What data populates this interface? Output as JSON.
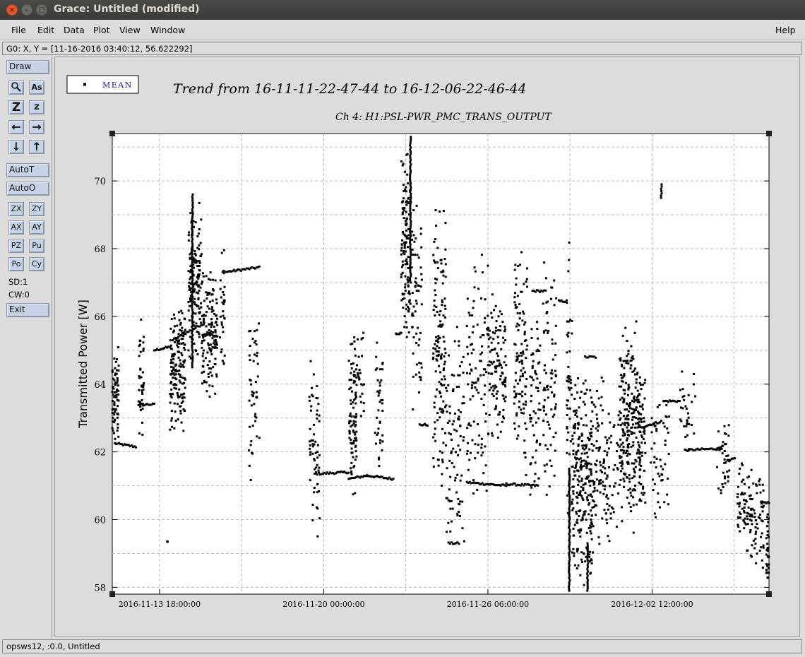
{
  "window": {
    "title": "Grace: Untitled (modified)",
    "close_glyph": "×",
    "min_glyph": "–",
    "max_glyph": "□"
  },
  "menu": {
    "file": "File",
    "edit": "Edit",
    "data": "Data",
    "plot": "Plot",
    "view": "View",
    "window": "Window",
    "help": "Help"
  },
  "locator": "G0: X, Y = [11-16-2016 03:40:12, 56.622292]",
  "toolbar": {
    "draw": "Draw",
    "autot": "AutoT",
    "autoo": "AutoO",
    "zx": "ZX",
    "zy": "ZY",
    "ax": "AX",
    "ay": "AY",
    "pz": "PZ",
    "pu": "Pu",
    "po": "Po",
    "cy": "Cy",
    "sd": "SD:1",
    "cw": "CW:0",
    "exit": "Exit",
    "zoom_icon": "magnifier-icon",
    "autoscale_text_icon": "As",
    "zoom_z_big": "Z",
    "zoom_z_small": "z",
    "left_arrow": "←",
    "right_arrow": "→",
    "down_arrow": "↓",
    "up_arrow": "↑"
  },
  "status": "opsws12, :0.0, Untitled",
  "chart_data": {
    "type": "scatter",
    "title": "Trend from 16-11-11-22-47-44 to 16-12-06-22-46-44",
    "subtitle": "Ch 4: H1:PSL-PWR_PMC_TRANS_OUTPUT",
    "ylabel": "Transmitted Power [W]",
    "xlabel": "",
    "legend": [
      "MEAN"
    ],
    "legend_position": "top-left",
    "grid": true,
    "ylim": [
      57.8,
      71.4
    ],
    "yticks": [
      58,
      60,
      62,
      64,
      66,
      68,
      70
    ],
    "xlim_days": [
      0,
      25
    ],
    "xtick_labels": [
      "2016-11-13 18:00:00",
      "2016-11-20 00:00:00",
      "2016-11-26 06:00:00",
      "2016-12-02 12:00:00"
    ],
    "xtick_days": [
      1.8,
      8.05,
      14.3,
      20.55
    ],
    "colors": {
      "marker": "#000000",
      "legend_text": "#1a1aa0",
      "grid": "#b8b8b8"
    },
    "series": [
      {
        "name": "MEAN",
        "flat_segments": [
          [
            0.1,
            0.9,
            62.25,
            62.15
          ],
          [
            1.0,
            1.6,
            63.4,
            63.4
          ],
          [
            1.6,
            2.2,
            65.0,
            65.1
          ],
          [
            2.3,
            3.5,
            65.3,
            65.8
          ],
          [
            3.5,
            4.0,
            65.5,
            65.4
          ],
          [
            4.2,
            5.6,
            67.3,
            67.45
          ],
          [
            7.7,
            9.0,
            61.35,
            61.4
          ],
          [
            9.0,
            9.7,
            61.2,
            61.3
          ],
          [
            9.7,
            10.7,
            61.3,
            61.2
          ],
          [
            10.8,
            11.0,
            65.5,
            65.5
          ],
          [
            11.7,
            12.0,
            62.8,
            62.8
          ],
          [
            12.8,
            13.2,
            59.3,
            59.3
          ],
          [
            13.5,
            15.0,
            61.1,
            61.0
          ],
          [
            15.0,
            16.2,
            61.05,
            61.0
          ],
          [
            16.0,
            16.5,
            66.75,
            66.75
          ],
          [
            17.0,
            17.3,
            66.45,
            66.45
          ],
          [
            18.0,
            18.4,
            64.8,
            64.8
          ],
          [
            20.0,
            20.9,
            62.7,
            62.9
          ],
          [
            21.0,
            21.6,
            63.5,
            63.5
          ],
          [
            21.8,
            23.2,
            62.05,
            62.1
          ],
          [
            23.3,
            23.7,
            61.7,
            61.8
          ],
          [
            24.7,
            25.0,
            60.5,
            60.5
          ]
        ],
        "clusters": [
          [
            0.0,
            0.25,
            62.2,
            65.2,
            70
          ],
          [
            1.0,
            1.2,
            61.8,
            66.0,
            40
          ],
          [
            2.2,
            2.8,
            62.5,
            66.5,
            160
          ],
          [
            2.9,
            3.4,
            64.5,
            69.6,
            140
          ],
          [
            3.4,
            4.0,
            63.5,
            67.6,
            130
          ],
          [
            4.1,
            4.3,
            64.2,
            68.4,
            30
          ],
          [
            5.2,
            5.6,
            61.0,
            66.2,
            50
          ],
          [
            7.5,
            7.9,
            59.3,
            64.8,
            60
          ],
          [
            9.0,
            9.3,
            60.2,
            65.6,
            90
          ],
          [
            9.3,
            9.6,
            62.6,
            65.7,
            25
          ],
          [
            10.0,
            10.3,
            61.0,
            65.5,
            40
          ],
          [
            11.0,
            11.35,
            65.0,
            71.3,
            120
          ],
          [
            11.4,
            11.8,
            62.8,
            69.7,
            60
          ],
          [
            12.2,
            12.7,
            60.5,
            69.7,
            140
          ],
          [
            12.7,
            13.4,
            59.0,
            66.0,
            90
          ],
          [
            13.5,
            14.3,
            60.0,
            68.6,
            100
          ],
          [
            14.3,
            15.0,
            62.0,
            67.0,
            120
          ],
          [
            15.3,
            15.8,
            61.0,
            68.3,
            110
          ],
          [
            15.9,
            16.3,
            60.0,
            67.0,
            60
          ],
          [
            16.4,
            16.9,
            60.0,
            68.0,
            80
          ],
          [
            17.3,
            17.5,
            58.5,
            69.2,
            50
          ],
          [
            17.5,
            18.3,
            58.0,
            64.3,
            260
          ],
          [
            18.3,
            18.7,
            59.0,
            65.0,
            60
          ],
          [
            18.7,
            19.3,
            59.0,
            63.5,
            60
          ],
          [
            19.3,
            20.1,
            59.5,
            66.0,
            240
          ],
          [
            20.0,
            20.3,
            59.8,
            64.5,
            60
          ],
          [
            20.5,
            21.2,
            59.8,
            63.8,
            50
          ],
          [
            21.6,
            22.2,
            62.0,
            64.5,
            30
          ],
          [
            23.0,
            23.5,
            60.5,
            63.2,
            40
          ],
          [
            23.8,
            24.3,
            58.8,
            61.9,
            60
          ],
          [
            24.3,
            24.8,
            58.5,
            61.5,
            60
          ],
          [
            24.9,
            25.0,
            57.9,
            60.5,
            30
          ]
        ],
        "spikes": [
          [
            20.9,
            69.5,
            69.9
          ],
          [
            3.05,
            64.5,
            69.6
          ],
          [
            11.35,
            67.0,
            71.3
          ],
          [
            17.4,
            57.9,
            61.5
          ],
          [
            18.1,
            57.9,
            59.3
          ],
          [
            2.1,
            59.35,
            59.35
          ]
        ]
      }
    ]
  }
}
